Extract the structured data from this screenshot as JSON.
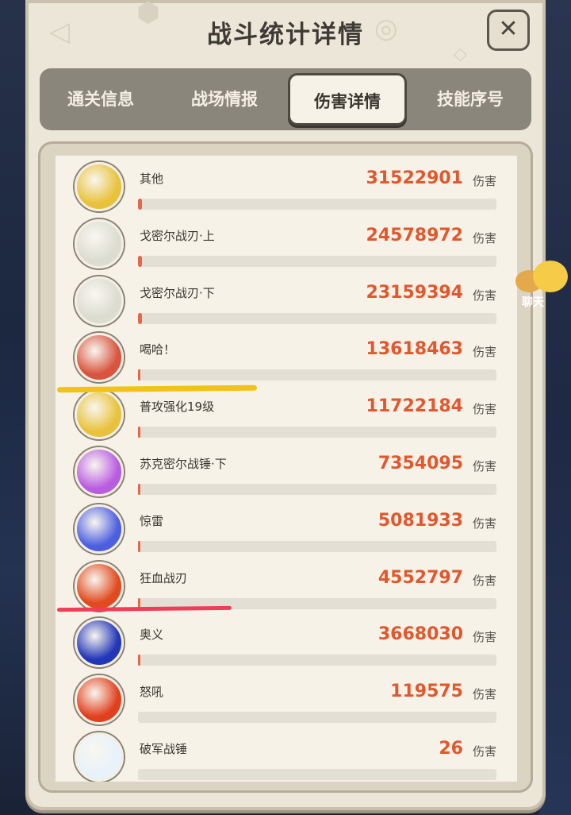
{
  "window": {
    "title": "战斗统计详情",
    "close_label": "✕"
  },
  "tabs": [
    {
      "label": "通关信息",
      "active": false
    },
    {
      "label": "战场情报",
      "active": false
    },
    {
      "label": "伤害详情",
      "active": true
    },
    {
      "label": "技能序号",
      "active": false
    }
  ],
  "unit_label": "伤害",
  "chat": {
    "label": "聊天"
  },
  "colors": {
    "damage_value": "#e0582e",
    "bar_fill": "#e06a4e",
    "bar_track": "#e4dfd4",
    "highlight_yellow": "#f3c21a",
    "highlight_red": "#ef3e58"
  },
  "rows": [
    {
      "name": "其他",
      "damage": "31522901",
      "icon": "stone-block-icon",
      "icon_bg": "#e8c23c",
      "fill": 0.01
    },
    {
      "name": "戈密尔战刃·上",
      "damage": "24578972",
      "icon": "hammer-block-icon",
      "icon_bg": "#dcdcd0",
      "fill": 0.01
    },
    {
      "name": "戈密尔战刃·下",
      "damage": "23159394",
      "icon": "hammer-block-icon",
      "icon_bg": "#dcdcd0",
      "fill": 0.01
    },
    {
      "name": "喝哈！",
      "damage": "13618463",
      "icon": "warrior-face-icon",
      "icon_bg": "#d8543e",
      "fill": 0.005
    },
    {
      "name": "普攻强化19级",
      "damage": "11722184",
      "icon": "stone-block-icon",
      "icon_bg": "#e8c23c",
      "fill": 0.005
    },
    {
      "name": "苏克密尔战锤·下",
      "damage": "7354095",
      "icon": "war-hammer-icon",
      "icon_bg": "#b85ce0",
      "fill": 0.003
    },
    {
      "name": "惊雷",
      "damage": "5081933",
      "icon": "lightning-icon",
      "icon_bg": "#4d5fe0",
      "fill": 0.002
    },
    {
      "name": "狂血战刃",
      "damage": "4552797",
      "icon": "blood-flame-icon",
      "icon_bg": "#e04a1e",
      "fill": 0.002
    },
    {
      "name": "奥义",
      "damage": "3668030",
      "icon": "vortex-icon",
      "icon_bg": "#2236b8",
      "fill": 0.001
    },
    {
      "name": "怒吼",
      "damage": "119575",
      "icon": "spear-icon",
      "icon_bg": "#e0401e",
      "fill": 0
    },
    {
      "name": "破军战锤",
      "damage": "26",
      "icon": "crystal-icon",
      "icon_bg": "#e8f2fa",
      "fill": 0
    }
  ]
}
